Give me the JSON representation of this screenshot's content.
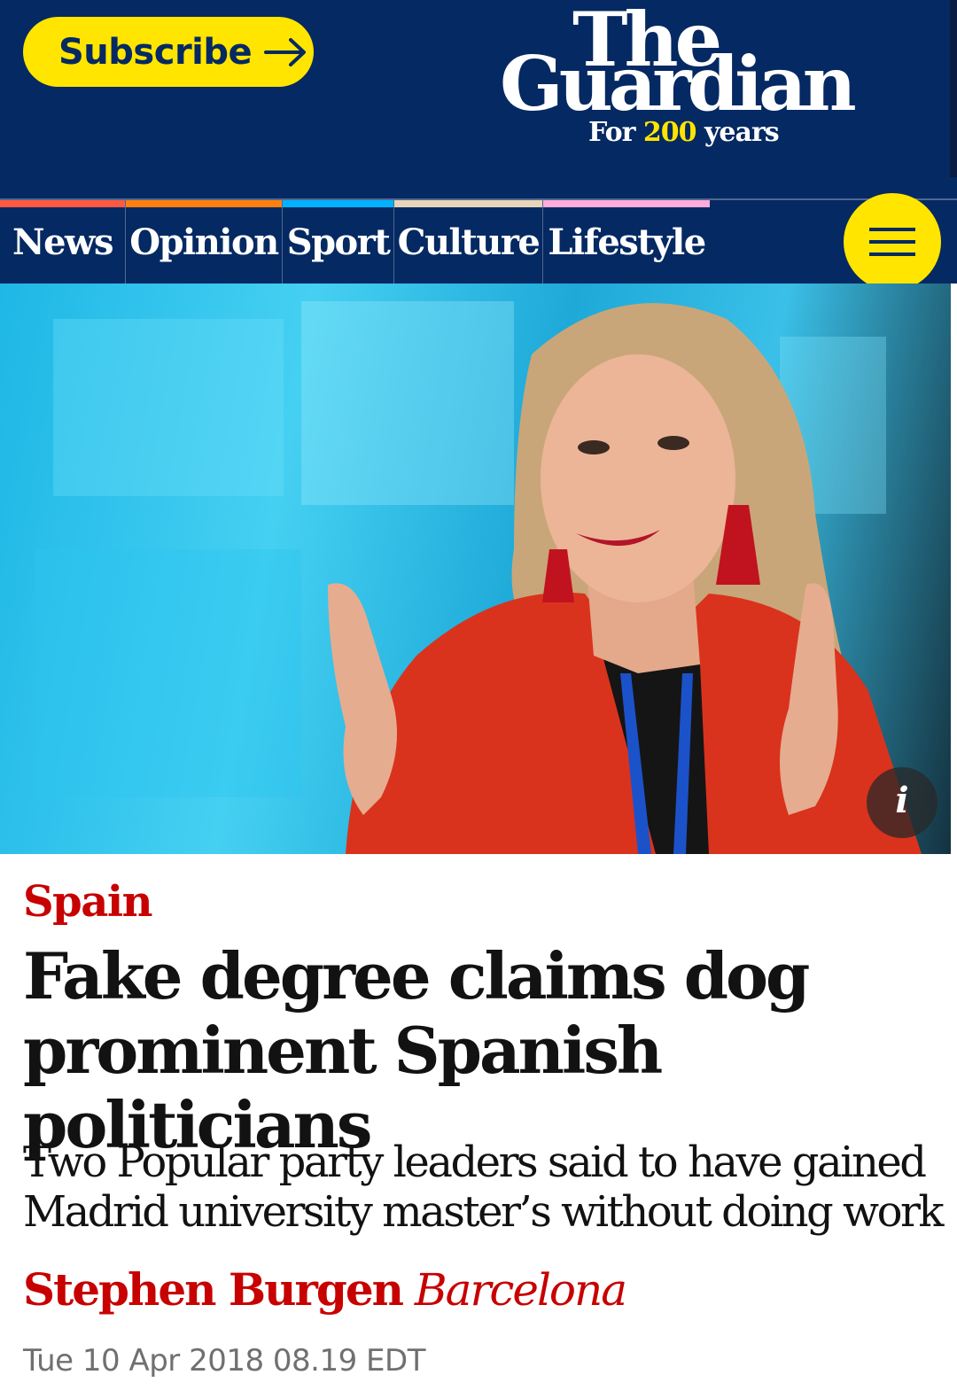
{
  "header": {
    "subscribe_label": "Subscribe",
    "subscribe_icon": "arrow-right-icon",
    "logo": {
      "line1": "The",
      "line2": "Guardian",
      "tag_prefix": "For ",
      "tag_number": "200",
      "tag_suffix": " years"
    },
    "menu_icon": "hamburger-menu-icon"
  },
  "nav": {
    "items": [
      {
        "label": "News",
        "color": "#ff5943"
      },
      {
        "label": "Opinion",
        "color": "#ff7f0f"
      },
      {
        "label": "Sport",
        "color": "#00b2ff"
      },
      {
        "label": "Culture",
        "color": "#e7d4b9"
      },
      {
        "label": "Lifestyle",
        "color": "#ffabdb"
      }
    ]
  },
  "hero": {
    "info_icon": "i"
  },
  "article": {
    "kicker": "Spain",
    "headline": "Fake degree claims dog prominent Spanish politicians",
    "standfirst": "Two Popular party leaders said to have gained Madrid university master’s without doing work",
    "author": "Stephen Burgen",
    "location": "Barcelona",
    "date": "Tue 10 Apr 2018 08.19 EDT"
  },
  "colors": {
    "brand_blue": "#052962",
    "brand_yellow": "#ffe500",
    "news_red": "#c70000"
  }
}
